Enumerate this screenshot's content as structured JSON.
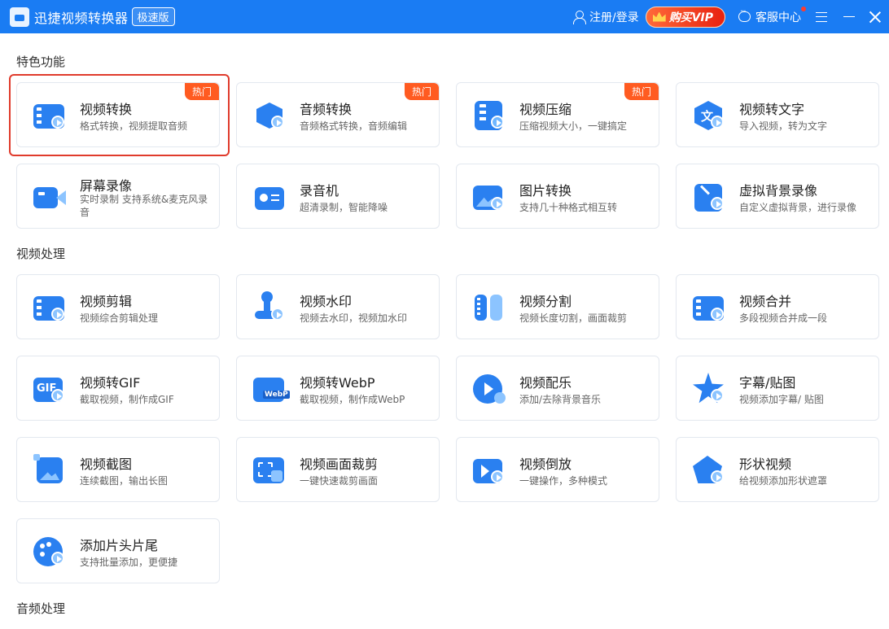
{
  "app": {
    "title": "迅捷视频转换器",
    "edition": "极速版"
  },
  "titlebar": {
    "login": "注册/登录",
    "vip": "购买VIP",
    "service": "客服中心"
  },
  "colors": {
    "primary": "#1a7cf3",
    "hot": "#ff5b21",
    "highlight": "#e03b2c"
  },
  "sections": {
    "s1": "特色功能",
    "s2": "视频处理",
    "s3": "音频处理"
  },
  "cards": [
    {
      "title": "视频转换",
      "desc": "格式转换，视频提取音频",
      "hot": "热门",
      "icon": "video-convert-icon"
    },
    {
      "title": "音频转换",
      "desc": "音频格式转换，音频编辑",
      "hot": "热门",
      "icon": "audio-convert-icon"
    },
    {
      "title": "视频压缩",
      "desc": "压缩视频大小，一键搞定",
      "hot": "热门",
      "icon": "video-compress-icon"
    },
    {
      "title": "视频转文字",
      "desc": "导入视频，转为文字",
      "icon": "video-to-text-icon"
    },
    {
      "title": "屏幕录像",
      "desc": "实时录制 支持系统&麦克风录音",
      "icon": "screen-record-icon"
    },
    {
      "title": "录音机",
      "desc": "超清录制，智能降噪",
      "icon": "recorder-icon"
    },
    {
      "title": "图片转换",
      "desc": "支持几十种格式相互转",
      "icon": "image-convert-icon"
    },
    {
      "title": "虚拟背景录像",
      "desc": "自定义虚拟背景，进行录像",
      "icon": "virtual-background-icon"
    },
    {
      "title": "视频剪辑",
      "desc": "视频综合剪辑处理",
      "icon": "video-edit-icon"
    },
    {
      "title": "视频水印",
      "desc": "视频去水印，视频加水印",
      "icon": "watermark-icon"
    },
    {
      "title": "视频分割",
      "desc": "视频长度切割，画面裁剪",
      "icon": "video-split-icon"
    },
    {
      "title": "视频合并",
      "desc": "多段视频合并成一段",
      "icon": "video-merge-icon"
    },
    {
      "title": "视频转GIF",
      "desc": "截取视频，制作成GIF",
      "icon": "gif-icon"
    },
    {
      "title": "视频转WebP",
      "desc": "截取视频，制作成WebP",
      "icon": "webp-icon"
    },
    {
      "title": "视频配乐",
      "desc": "添加/去除背景音乐",
      "icon": "music-icon"
    },
    {
      "title": "字幕/贴图",
      "desc": "视频添加字幕/ 贴图",
      "icon": "subtitle-sticker-icon"
    },
    {
      "title": "视频截图",
      "desc": "连续截图，输出长图",
      "icon": "screenshot-icon"
    },
    {
      "title": "视频画面裁剪",
      "desc": "一键快速裁剪画面",
      "icon": "crop-icon"
    },
    {
      "title": "视频倒放",
      "desc": "一键操作，多种模式",
      "icon": "reverse-icon"
    },
    {
      "title": "形状视频",
      "desc": "给视频添加形状遮罩",
      "icon": "shape-icon"
    },
    {
      "title": "添加片头片尾",
      "desc": "支持批量添加，更便捷",
      "icon": "intro-outro-icon"
    }
  ],
  "icon_labels": {
    "gif": "GIF",
    "webp": "WebP",
    "text": "文"
  }
}
